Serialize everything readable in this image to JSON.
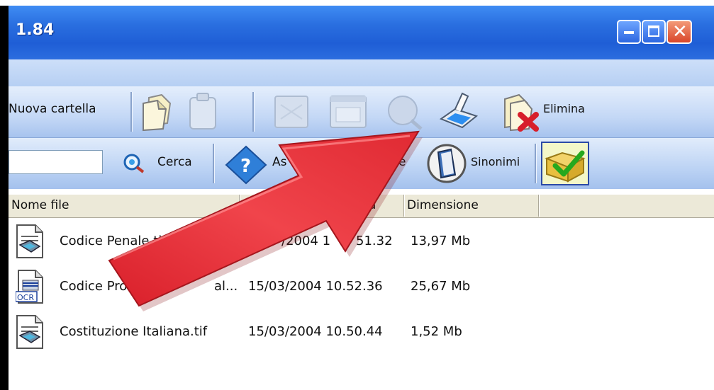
{
  "window": {
    "title": "1.84",
    "controls": [
      "minimize",
      "maximize",
      "close"
    ]
  },
  "toolbar1": {
    "new_folder_label": "Nuova cartella",
    "delete_label": "Elimina",
    "icons": [
      "copy-icon",
      "paste-icon",
      "disabled-icon",
      "window-icon",
      "search-globe-icon",
      "scanner-icon",
      "delete-icon"
    ]
  },
  "toolbar2": {
    "search_value": "",
    "search_button_label": "Cerca",
    "assist_label": "As",
    "assist_label_suffix": "e",
    "synonyms_label": "Sinonimi"
  },
  "table": {
    "columns": [
      "Nome file",
      "D",
      "a",
      "Dimensione"
    ],
    "rows": [
      {
        "name": "Codice Penale.tif",
        "date": "/2004 1",
        "date_tail": "51.32",
        "size": "13,97 Mb",
        "icon": "tif-file-icon"
      },
      {
        "name": "Codice Proce",
        "name_tail": "al...",
        "date": "15/03/2004 10.52.36",
        "size": "25,67 Mb",
        "icon": "ocr-file-icon"
      },
      {
        "name": "Costituzione Italiana.tif",
        "date": "15/03/2004 10.50.44",
        "size": "1,52 Mb",
        "icon": "tif-file-icon"
      }
    ]
  },
  "colors": {
    "titlebar": "#2a6fe0",
    "arrow": "#e8343a",
    "header_bg": "#ece9d8"
  }
}
